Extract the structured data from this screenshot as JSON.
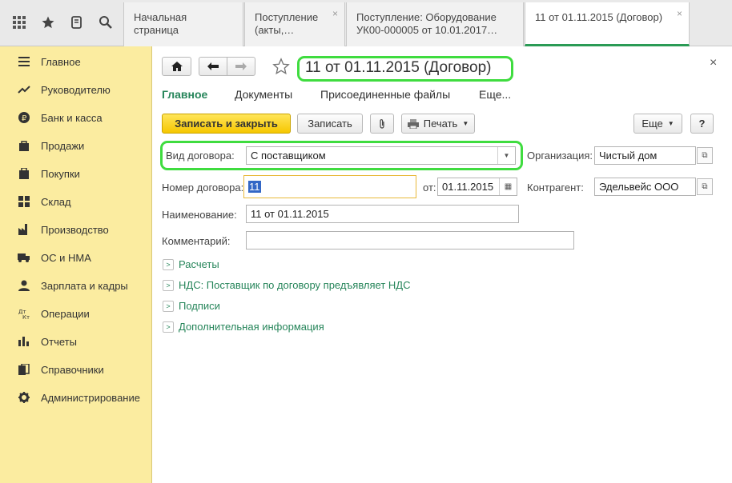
{
  "topbar": {
    "icons": [
      "apps-grid-icon",
      "star-icon",
      "history-icon",
      "search-icon"
    ],
    "tabs": [
      {
        "label": "Начальная страница"
      },
      {
        "label": "Поступление\n(акты,…"
      },
      {
        "label": "Поступление: Оборудование\nУК00-000005 от 10.01.2017…"
      },
      {
        "label": "11 от 01.11.2015 (Договор)"
      }
    ],
    "close_glyph": "×"
  },
  "sidebar": {
    "items": [
      {
        "label": "Главное",
        "icon": "menu-icon"
      },
      {
        "label": "Руководителю",
        "icon": "trend-icon"
      },
      {
        "label": "Банк и касса",
        "icon": "ruble-icon"
      },
      {
        "label": "Продажи",
        "icon": "bag-icon"
      },
      {
        "label": "Покупки",
        "icon": "cart-icon"
      },
      {
        "label": "Склад",
        "icon": "warehouse-icon"
      },
      {
        "label": "Производство",
        "icon": "factory-icon"
      },
      {
        "label": "ОС и НМА",
        "icon": "truck-icon"
      },
      {
        "label": "Зарплата и кадры",
        "icon": "people-icon"
      },
      {
        "label": "Операции",
        "icon": "debit-credit-icon"
      },
      {
        "label": "Отчеты",
        "icon": "bar-chart-icon"
      },
      {
        "label": "Справочники",
        "icon": "books-icon"
      },
      {
        "label": "Администрирование",
        "icon": "gear-icon"
      }
    ]
  },
  "document": {
    "title": "11 от 01.11.2015 (Договор)",
    "close_glyph": "×",
    "nav_tabs": [
      "Главное",
      "Документы",
      "Присоединенные файлы",
      "Еще..."
    ],
    "toolbar": {
      "save_close": "Записать и закрыть",
      "save": "Записать",
      "print": "Печать",
      "more": "Еще",
      "help": "?"
    },
    "form": {
      "contract_type_label": "Вид договора:",
      "contract_type_value": "С поставщиком",
      "org_label": "Организация:",
      "org_value": "Чистый дом",
      "number_label": "Номер договора:",
      "number_value": "11",
      "date_label": "от:",
      "date_value": "01.11.2015",
      "counterparty_label": "Контрагент:",
      "counterparty_value": "Эдельвейс ООО",
      "name_label": "Наименование:",
      "name_value": "11 от 01.11.2015",
      "comment_label": "Комментарий:",
      "comment_value": ""
    },
    "groups": [
      "Расчеты",
      "НДС: Поставщик по договору предъявляет НДС",
      "Подписи",
      "Дополнительная информация"
    ]
  },
  "colors": {
    "accent_green": "#26855a",
    "highlight": "#3fdc3f",
    "sidebar_bg": "#fbeca0",
    "primary_button": "#f6c700"
  }
}
